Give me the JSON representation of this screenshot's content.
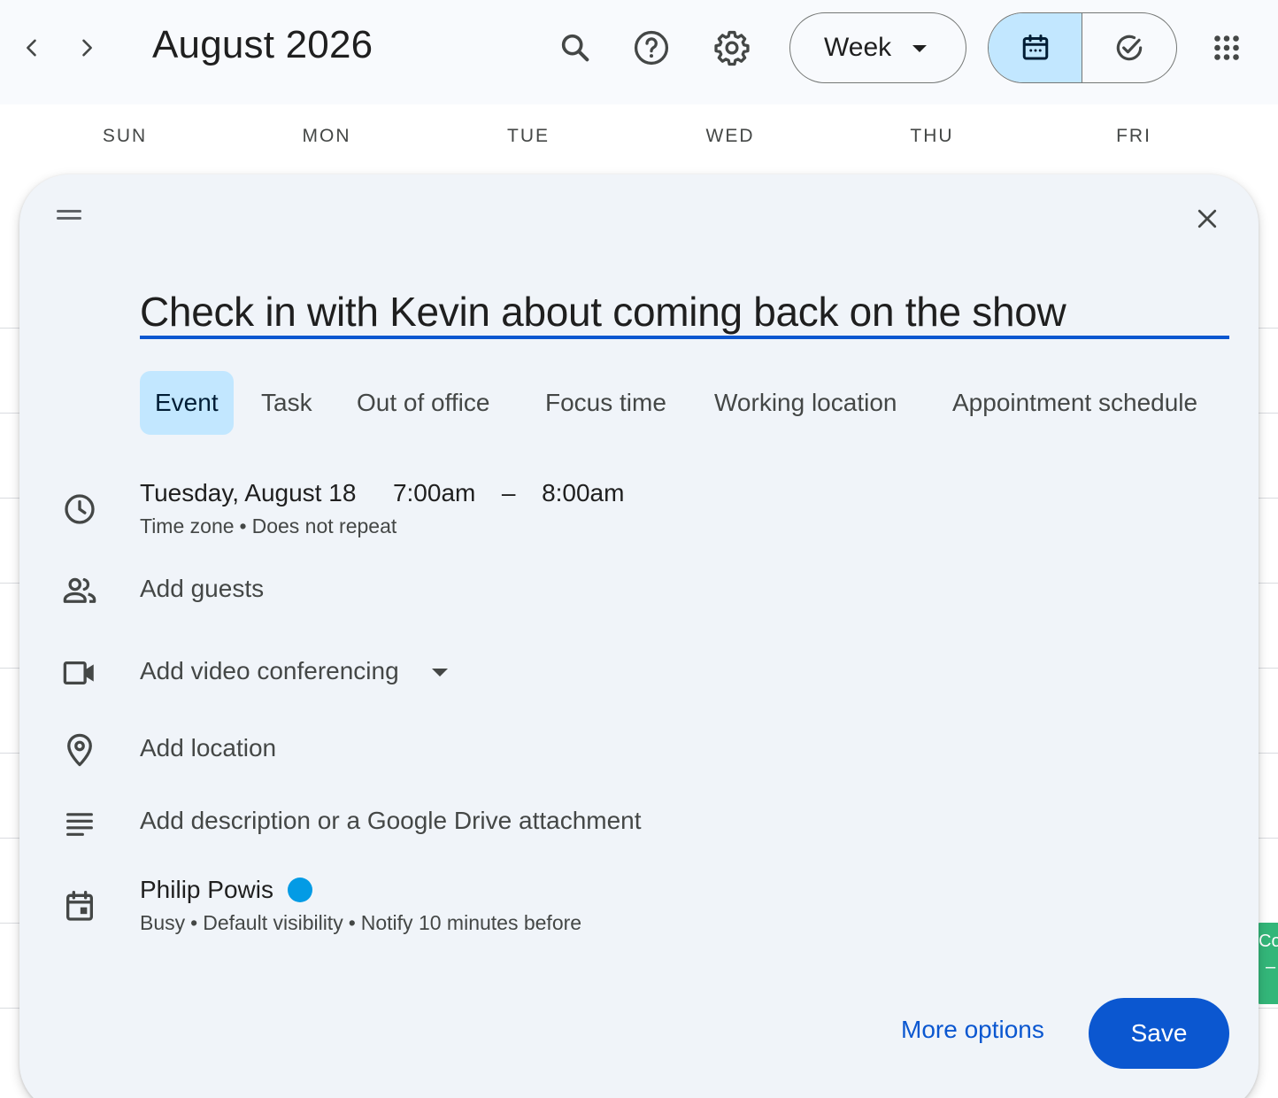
{
  "header": {
    "month_title": "August 2026",
    "view_select": "Week"
  },
  "days": [
    "SUN",
    "MON",
    "TUE",
    "WED",
    "THU",
    "FRI"
  ],
  "dialog": {
    "title_value": "Check in with Kevin about coming back on the show",
    "tabs": [
      {
        "label": "Event",
        "active": true
      },
      {
        "label": "Task",
        "active": false
      },
      {
        "label": "Out of office",
        "active": false
      },
      {
        "label": "Focus time",
        "active": false
      },
      {
        "label": "Working location",
        "active": false
      },
      {
        "label": "Appointment schedule",
        "active": false
      }
    ],
    "date": "Tuesday, August 18",
    "start_time": "7:00am",
    "dash": "–",
    "end_time": "8:00am",
    "time_zone": "Time zone",
    "repeat": "Does not repeat",
    "add_guests": "Add guests",
    "add_video": "Add video conferencing",
    "add_location": "Add location",
    "add_description": "Add description or a Google Drive attachment",
    "owner_name": "Philip Powis",
    "busy": "Busy",
    "visibility": "Default visibility",
    "notify": "Notify 10 minutes before",
    "more_options": "More options",
    "save": "Save",
    "separator": "•"
  },
  "background": {
    "chip_text": "Coa",
    "chip_sub": "–"
  },
  "icons": {
    "prev": "chevron-left-icon",
    "next": "chevron-right-icon",
    "search": "search-icon",
    "help": "help-icon",
    "settings": "gear-icon",
    "calendar": "calendar-icon",
    "tasks": "check-circle-icon",
    "apps": "apps-grid-icon",
    "close": "close-icon",
    "clock": "clock-icon",
    "guests": "people-icon",
    "video": "video-camera-icon",
    "location": "location-pin-icon",
    "description": "notes-icon",
    "calendar_owner": "event-calendar-icon"
  },
  "colors": {
    "accent": "#0b57d0",
    "selected": "#c2e7ff",
    "calendar_dot": "#039be5",
    "dialog_bg": "#f0f4f9",
    "chip": "#33b679"
  }
}
